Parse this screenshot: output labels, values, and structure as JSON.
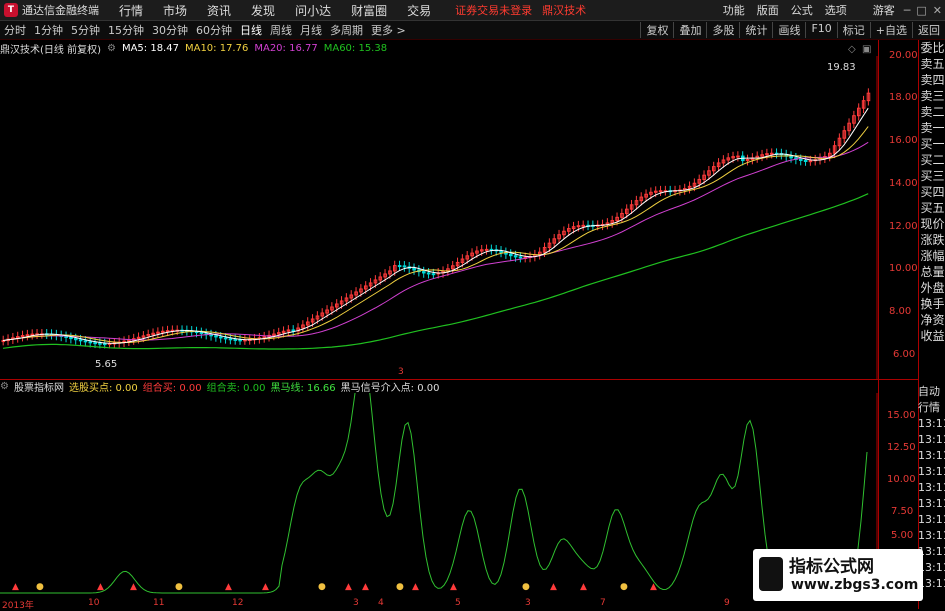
{
  "menubar": {
    "app_title": "通达信金融终端",
    "items": [
      "行情",
      "市场",
      "资讯",
      "发现",
      "问小达",
      "财富圈",
      "交易"
    ],
    "status": "证券交易未登录",
    "status_stock": "鼎汉技术",
    "right_items": [
      "功能",
      "版面",
      "公式",
      "选项"
    ],
    "guest": "游客"
  },
  "periodbar": {
    "periods": [
      "分时",
      "1分钟",
      "5分钟",
      "15分钟",
      "30分钟",
      "60分钟",
      "日线",
      "周线",
      "月线",
      "多周期",
      "更多 >"
    ],
    "active": "日线",
    "right_buttons": [
      "复权",
      "叠加",
      "多股",
      "统计",
      "画线",
      "F10",
      "标记",
      "+自选",
      "返回"
    ]
  },
  "ma_legend": {
    "title": "鼎汉技术(日线 前复权)",
    "ma5": "MA5: 18.47",
    "ma10": "MA10: 17.76",
    "ma20": "MA20: 16.77",
    "ma60": "MA60: 15.38"
  },
  "main_chart": {
    "y_ticks": [
      "20.00",
      "18.00",
      "16.00",
      "14.00",
      "12.00",
      "10.00",
      "8.00",
      "6.00"
    ],
    "high_label": "19.83",
    "low_label": "5.65",
    "colors": {
      "up": "#ff3b3b",
      "down": "#00d8d8",
      "ma5": "#ffffff",
      "ma10": "#f0d040",
      "ma20": "#d040d0",
      "ma60": "#20c020"
    },
    "marker": "3"
  },
  "ind_legend": {
    "name": "股票指标网",
    "buy": "选股买点: 0.00",
    "combo_buy": "组合买: 0.00",
    "combo_sell": "组合卖: 0.00",
    "blackhorse": "黑马线: 16.66",
    "blackhorse_entry": "黑马信号介入点: 0.00"
  },
  "ind_chart": {
    "y_ticks": [
      "15.00",
      "12.50",
      "10.00",
      "7.50",
      "5.00"
    ]
  },
  "date_axis": {
    "labels": [
      "2013年",
      "10",
      "11",
      "12",
      "3",
      "4",
      "5",
      "6",
      "7",
      "9"
    ]
  },
  "right_panel": {
    "top": [
      "委比",
      "卖五",
      "卖四",
      "卖三",
      "卖二",
      "卖一",
      "买一",
      "买二",
      "买三",
      "买四",
      "买五",
      "现价",
      "涨跌",
      "涨幅",
      "总量",
      "外盘",
      "换手",
      "净资",
      "收益"
    ],
    "bottom": [
      "自动",
      "行情",
      "13:11",
      "13:11",
      "13:11",
      "13:11",
      "13:11",
      "13:11",
      "13:11",
      "13:11",
      "13:11",
      "13:11",
      "13:11"
    ]
  },
  "watermark": {
    "line1": "指标公式网",
    "line2": "www.zbgs3.com"
  }
}
